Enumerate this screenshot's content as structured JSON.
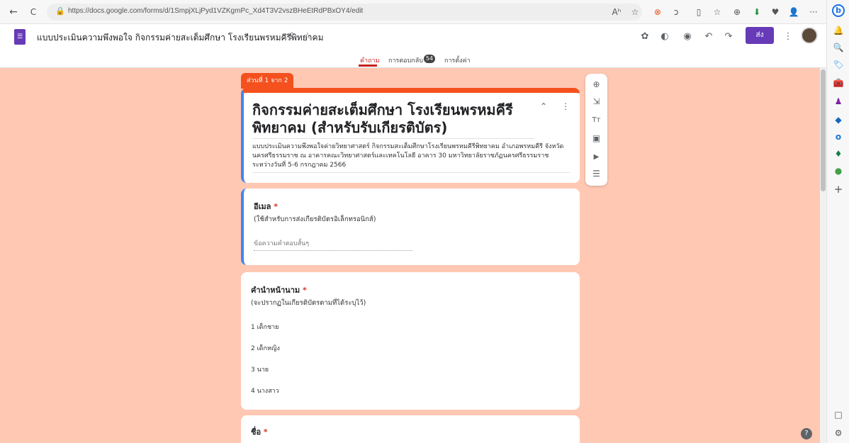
{
  "browser": {
    "url": "https://docs.google.com/forms/d/1SmpjXLjPyd1VZKgmPc_Xd4T3V2vszBHeEtRdPBxOY4/edit",
    "back_icon": "←",
    "refresh_icon": "C",
    "lock_icon": "🔒",
    "toolbar_icons": [
      "Aʰ",
      "☆",
      "⊗",
      "ↄ",
      "▯",
      "☆",
      "⊕",
      "⬇",
      "♥",
      "👤",
      "···"
    ]
  },
  "edge_sidebar": {
    "icons": [
      "b",
      "🔔",
      "🔍",
      "🏷",
      "🧰",
      "♟",
      "◆",
      "o",
      "♦",
      "●",
      "+",
      "□",
      "⚙"
    ],
    "colors": [
      "#1a73e8",
      "#1a73e8",
      "#555555",
      "#2196f3",
      "#e65100",
      "#7b1fa2",
      "#1565c0",
      "#1976d2",
      "#0b8043",
      "#43a047",
      "#555555",
      "#555555",
      "#555555"
    ]
  },
  "form_header": {
    "logo_icon": "☰",
    "doc_title": "แบบประเมินความพึงพอใจ กิจกรรมค่ายสะเต็มศึกษา โรงเรียนพรหมคีรีพิทยาคม",
    "title_icons": [
      "⇪",
      "☆"
    ],
    "right_icons": [
      "✿",
      "◐",
      "◉",
      "↶",
      "↷"
    ],
    "send_label": "ส่ง",
    "more_icon": "⋮",
    "tabs": {
      "questions": "คำถาม",
      "responses": "การตอบกลับ",
      "responses_count": "54",
      "settings": "การตั้งค่า"
    }
  },
  "section": {
    "tab_label": "ส่วนที่ 1 จาก 2",
    "title": "กิจกรรมค่ายสะเต็มศึกษา โรงเรียนพรหมคีรีพิทยาคม (สำหรับรับเกียรติบัตร)",
    "description": "แบบประเมินความพึงพอใจค่ายวิทยาศาสตร์ กิจกรรมสะเต็มศึกษาโรงเรียนพรหมคีรีพิทยาคม อำเภอพรหมคีรี จังหวัดนครศรีธรรมราช ณ อาคารคณะวิทยาศาสตร์และเทคโนโลยี อาคาร 30 มหาวิทยาลัยราชภัฏนครศรีธรรมราช ระหว่างวันที่ 5-6 กรกฎาคม 2566",
    "collapse_icon": "⌃",
    "more_icon": "⋮"
  },
  "questions": [
    {
      "title": "อีเมล",
      "required": "*",
      "help": "(ใช้สำหรับการส่งเกียรติบัตรอิเล็กทรอนิกส์)",
      "placeholder": "ข้อความคำตอบสั้นๆ"
    },
    {
      "title": "คำนำหน้านาม",
      "required": "*",
      "help": "(จะปรากฏในเกียรติบัตรตามที่ได้ระบุไว้)",
      "options": [
        "1  เด็กชาย",
        "2  เด็กหญิง",
        "3  นาย",
        "4  นางสาว"
      ]
    },
    {
      "title": "ชื่อ",
      "required": "*"
    }
  ],
  "toolbar": {
    "icons": [
      "⊕",
      "⇲",
      "Tт",
      "▣",
      "▶",
      "☰"
    ]
  },
  "help_icon": "?",
  "theme": {
    "accent": "#f4511e",
    "background": "#ffc8b3",
    "brand": "#673ab7"
  }
}
